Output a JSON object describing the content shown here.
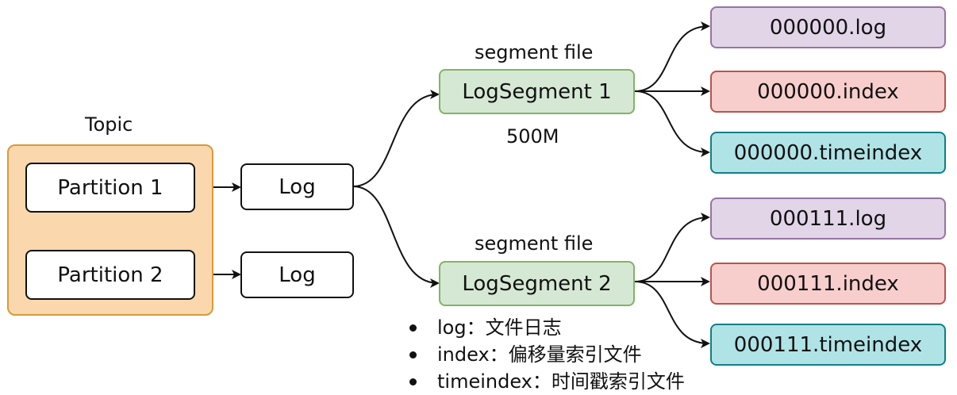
{
  "topic": {
    "label": "Topic",
    "partitions": [
      "Partition 1",
      "Partition 2"
    ]
  },
  "logs": [
    "Log",
    "Log"
  ],
  "segments": [
    {
      "caption": "segment file",
      "label": "LogSegment 1",
      "size": "500M",
      "files": [
        "000000.log",
        "000000.index",
        "000000.timeindex"
      ]
    },
    {
      "caption": "segment file",
      "label": "LogSegment 2",
      "files": [
        "000111.log",
        "000111.index",
        "000111.timeindex"
      ]
    }
  ],
  "file_colors": {
    "log": "#e1d5e7",
    "index": "#f8cecc",
    "timeindex": "#b0e3e6"
  },
  "file_borders": {
    "log": "#9673a6",
    "index": "#b85450",
    "timeindex": "#0e8088"
  },
  "notes": [
    "log：文件日志",
    "index：偏移量索引文件",
    "timeindex：时间戳索引文件"
  ]
}
